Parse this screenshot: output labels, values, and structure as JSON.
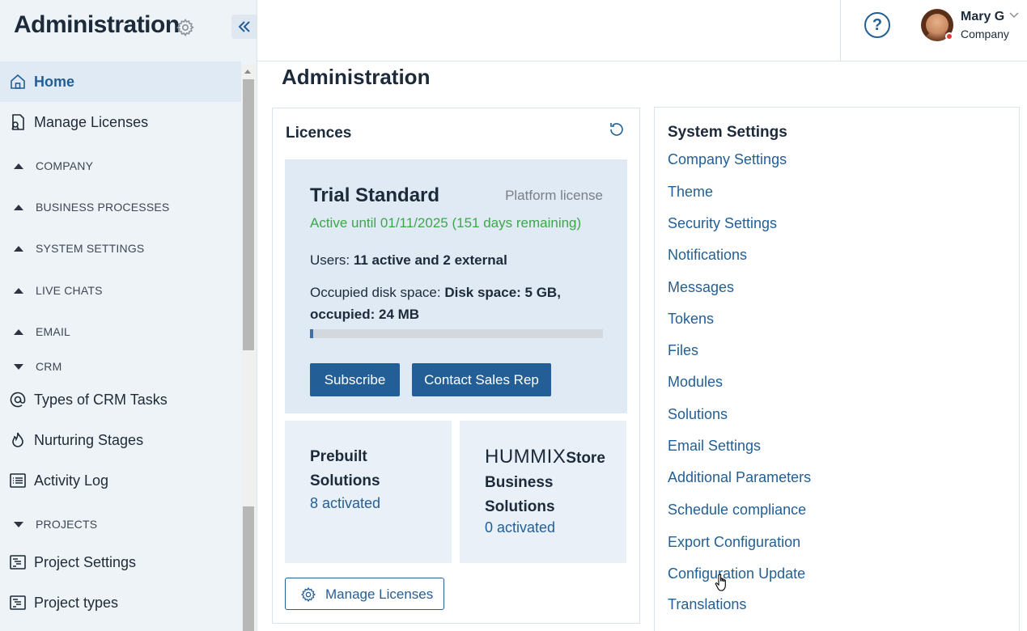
{
  "sidebar": {
    "title": "Administration",
    "items": [
      {
        "label": "Home",
        "icon": "home-icon",
        "active": true
      },
      {
        "label": "Manage Licenses",
        "icon": "license-icon"
      },
      {
        "label": "COMPANY",
        "type": "section",
        "expanded": false
      },
      {
        "label": "BUSINESS PROCESSES",
        "type": "section",
        "expanded": false
      },
      {
        "label": "SYSTEM SETTINGS",
        "type": "section",
        "expanded": false
      },
      {
        "label": "LIVE CHATS",
        "type": "section",
        "expanded": false
      },
      {
        "label": "EMAIL",
        "type": "section",
        "expanded": false
      },
      {
        "label": "CRM",
        "type": "section",
        "expanded": true
      },
      {
        "label": "Types of CRM Tasks",
        "icon": "at-icon"
      },
      {
        "label": "Nurturing Stages",
        "icon": "flame-icon"
      },
      {
        "label": "Activity Log",
        "icon": "list-icon"
      },
      {
        "label": "PROJECTS",
        "type": "section",
        "expanded": true
      },
      {
        "label": "Project Settings",
        "icon": "project-icon"
      },
      {
        "label": "Project types",
        "icon": "project-icon"
      }
    ]
  },
  "header": {
    "help_icon": "?",
    "user": {
      "name": "Mary G",
      "company": "Company",
      "status_color": "#e53935"
    }
  },
  "main": {
    "title": "Administration",
    "licences": {
      "title": "Licences",
      "plan_name": "Trial Standard",
      "plan_type": "Platform license",
      "active_text": "Active until 01/11/2025 (151 days remaining)",
      "users_label": "Users: ",
      "users_value": "11 active and 2 external",
      "disk_label": "Occupied disk space: ",
      "disk_value": "Disk space: 5 GB, occupied: 24 MB",
      "usage_percent": 1,
      "subscribe_label": "Subscribe",
      "contact_label": "Contact Sales Rep",
      "prebuilt_title": "Prebuilt Solutions",
      "prebuilt_link": "8 activated",
      "store_brand": "HUMMIX",
      "store_title_suffix": "Store",
      "store_title_rest": "Business Solutions",
      "store_link": "0 activated",
      "manage_label": "Manage Licenses"
    },
    "system_settings": {
      "title": "System Settings",
      "links": [
        "Company Settings",
        "Theme",
        "Security Settings",
        "Notifications",
        "Messages",
        "Tokens",
        "Files",
        "Modules",
        "Solutions",
        "Email Settings",
        "Additional Parameters",
        "Schedule compliance",
        "Export Configuration",
        "Configuration Update",
        "Translations"
      ]
    }
  },
  "colors": {
    "accent": "#235f96",
    "success": "#3ea64a",
    "sidebar_bg": "#eef3f8",
    "plan_bg": "#dfeaf5"
  }
}
